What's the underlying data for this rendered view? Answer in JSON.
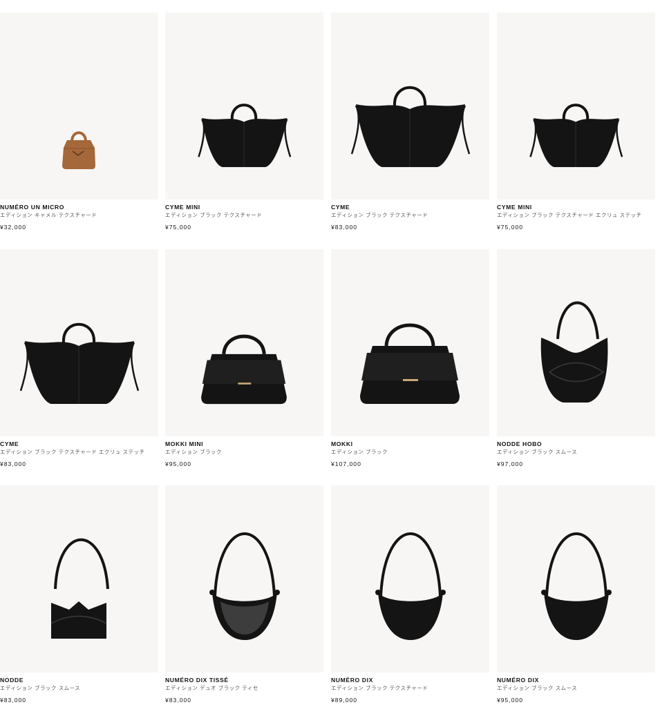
{
  "products": [
    {
      "name": "NUMÉRO UN MICRO",
      "edition": "エディション キャメル テクスチャード",
      "price": "¥32,000",
      "shape": "micro",
      "color": "#a5683a"
    },
    {
      "name": "CYME MINI",
      "edition": "エディション ブラック テクスチャード",
      "price": "¥75,000",
      "shape": "cyme-mini",
      "color": "#141414"
    },
    {
      "name": "CYME",
      "edition": "エディション ブラック テクスチャード",
      "price": "¥83,000",
      "shape": "cyme",
      "color": "#141414"
    },
    {
      "name": "CYME MINI",
      "edition": "エディション ブラック テクスチャード エクリュ ステッチ",
      "price": "¥75,000",
      "shape": "cyme-mini",
      "color": "#141414"
    },
    {
      "name": "CYME",
      "edition": "エディション ブラック テクスチャード エクリュ ステッチ",
      "price": "¥83,000",
      "shape": "cyme",
      "color": "#141414"
    },
    {
      "name": "MOKKI MINI",
      "edition": "エディション ブラック",
      "price": "¥95,000",
      "shape": "mokki-mini",
      "color": "#141414"
    },
    {
      "name": "MOKKI",
      "edition": "エディション ブラック",
      "price": "¥107,000",
      "shape": "mokki",
      "color": "#141414"
    },
    {
      "name": "NODDE HOBO",
      "edition": "エディション ブラック スムース",
      "price": "¥97,000",
      "shape": "hobo",
      "color": "#141414"
    },
    {
      "name": "NODDE",
      "edition": "エディション ブラック スムース",
      "price": "¥83,000",
      "shape": "nodde",
      "color": "#141414"
    },
    {
      "name": "NUMÉRO DIX TISSÉ",
      "edition": "エディション デュオ ブラック ティセ",
      "price": "¥83,000",
      "shape": "dix-tisse",
      "color": "#141414"
    },
    {
      "name": "NUMÉRO DIX",
      "edition": "エディション ブラック テクスチャード",
      "price": "¥89,000",
      "shape": "dix",
      "color": "#141414"
    },
    {
      "name": "NUMÉRO DIX",
      "edition": "エディション ブラック スムース",
      "price": "¥95,000",
      "shape": "dix",
      "color": "#141414"
    }
  ],
  "logo_icon": "polene-monogram-icon",
  "background_color": "#f7f6f4"
}
